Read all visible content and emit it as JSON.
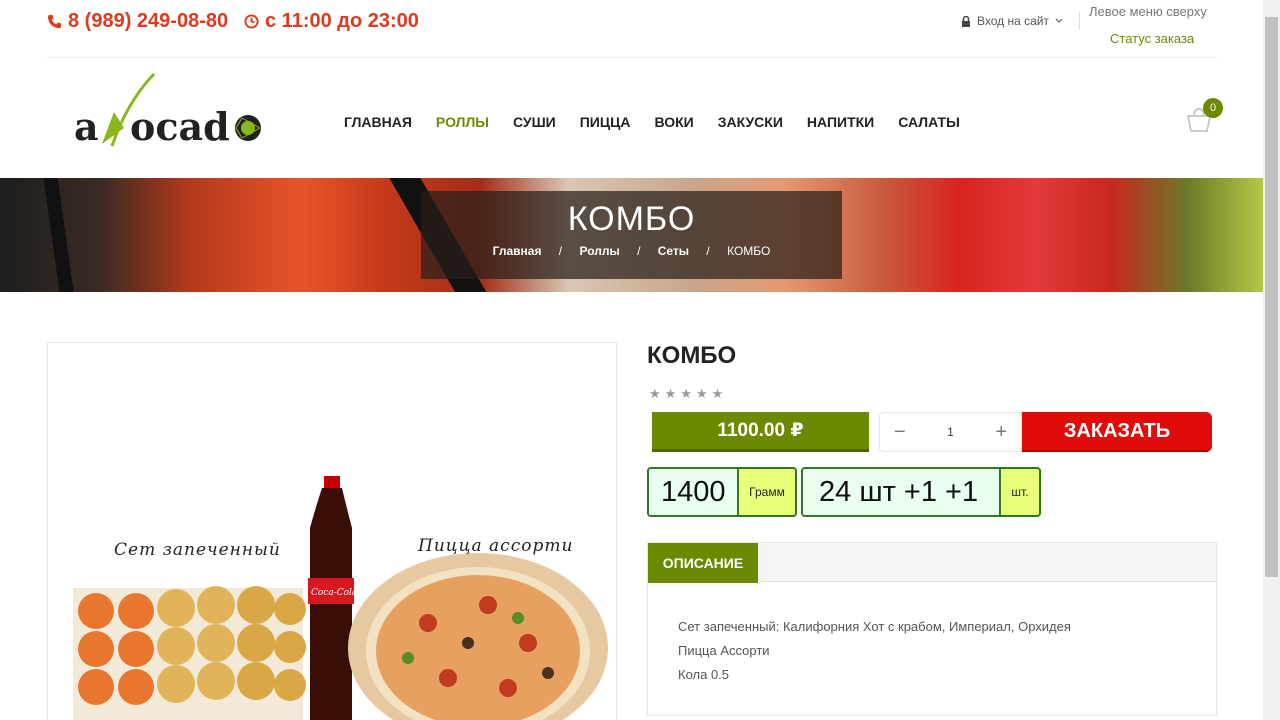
{
  "topbar": {
    "phone": "8 (989) 249-08-80",
    "hours": "с 11:00 до 23:00",
    "login": "Вход на сайт",
    "menu_top": "Левое меню сверху",
    "order_status": "Статус заказа"
  },
  "logo_text": "avocado",
  "nav": [
    "ГЛАВНАЯ",
    "РОЛЛЫ",
    "СУШИ",
    "ПИЦЦА",
    "ВОКИ",
    "ЗАКУСКИ",
    "НАПИТКИ",
    "САЛАТЫ"
  ],
  "nav_active": "РОЛЛЫ",
  "cart": {
    "count": "0"
  },
  "banner": {
    "title": "КОМБО",
    "breadcrumbs": [
      "Главная",
      "Роллы",
      "Сеты",
      "КОМБО"
    ],
    "separator": "/"
  },
  "product": {
    "title": "КОМБО",
    "rating": 5,
    "price": "1100.00 ₽",
    "quantity": "1",
    "order_button": "ЗАКАЗАТЬ",
    "weight_value": "1400",
    "weight_unit": "Грамм",
    "pieces_value": "24 шт +1 +1",
    "pieces_unit": "шт.",
    "image_labels": {
      "set": "Сет запеченный",
      "pizza": "Пицца ассорти",
      "cola_brand": "Coca-Cola"
    }
  },
  "tabs": {
    "description": "ОПИСАНИЕ"
  },
  "description_lines": [
    "Сет запеченный: Калифорния Хот с крабом, Империал, Орхидея",
    "Пицца Ассорти",
    "Кола 0.5"
  ],
  "colors": {
    "accent_green": "#6b8a00",
    "accent_red": "#e00b0b",
    "contact_red": "#e03a1e"
  }
}
